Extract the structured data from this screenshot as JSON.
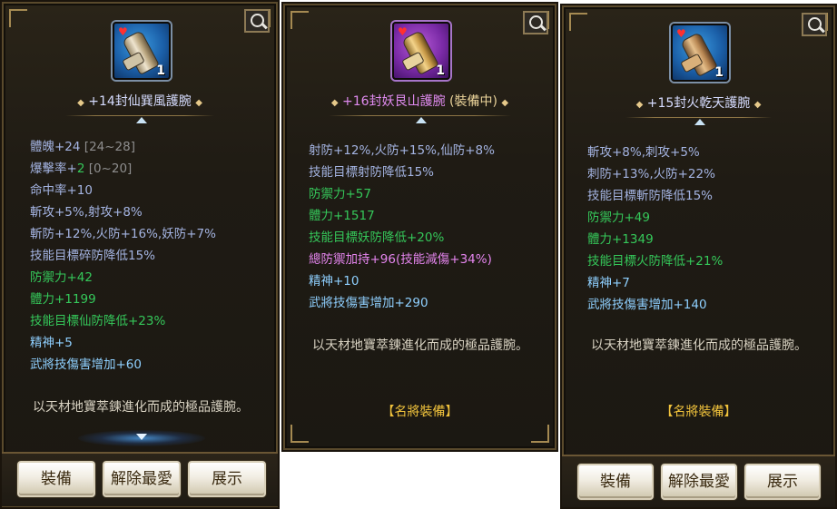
{
  "panels": [
    {
      "title": "+14封仙巽風護腕",
      "title_color": "#d6dcff",
      "icon": "bracer-icon",
      "icon_count": "1",
      "stats": [
        {
          "text": "體魄+24",
          "extra": "[24~28]",
          "color": "blue"
        },
        {
          "text": "爆擊率+",
          "extra_green": "2",
          "extra": "[0~20]",
          "color": "blue"
        },
        {
          "text": "命中率+10",
          "color": "blue"
        },
        {
          "text": "斬攻+5%,射攻+8%",
          "color": "blue"
        },
        {
          "text": "斬防+12%,火防+16%,妖防+7%",
          "color": "blue"
        },
        {
          "text": "技能目標碎防降低15%",
          "color": "blue"
        },
        {
          "text": "防禦力+42",
          "color": "green"
        },
        {
          "text": "體力+1199",
          "color": "green"
        },
        {
          "text": "技能目標仙防降低+23%",
          "color": "green"
        },
        {
          "text": "精神+5",
          "color": "cyan"
        },
        {
          "text": "武將技傷害增加+60",
          "color": "cyan"
        }
      ],
      "description": "以天材地寶萃鍊進化而成的極品護腕。",
      "buttons": [
        "裝備",
        "解除最愛",
        "展示"
      ]
    },
    {
      "title": "+16封妖艮山護腕",
      "title_suffix": "(裝備中)",
      "title_color": "#e08bf0",
      "icon": "bracer-icon",
      "icon_count": "1",
      "stats": [
        {
          "text": "射防+12%,火防+15%,仙防+8%",
          "color": "blue"
        },
        {
          "text": "技能目標射防降低15%",
          "color": "blue"
        },
        {
          "text": "防禦力+57",
          "color": "green"
        },
        {
          "text": "體力+1517",
          "color": "green"
        },
        {
          "text": "技能目標妖防降低+20%",
          "color": "green"
        },
        {
          "text": "總防禦加持+96(技能減傷+34%)",
          "color": "pink"
        },
        {
          "text": "精神+10",
          "color": "cyan"
        },
        {
          "text": "武將技傷害增加+290",
          "color": "cyan"
        }
      ],
      "description": "以天材地寶萃鍊進化而成的極品護腕。",
      "tag": "【名將裝備】"
    },
    {
      "title": "+15封火乾天護腕",
      "title_color": "#d6dcff",
      "icon": "bracer-icon",
      "icon_count": "1",
      "stats": [
        {
          "text": "斬攻+8%,刺攻+5%",
          "color": "blue"
        },
        {
          "text": "刺防+13%,火防+22%",
          "color": "blue"
        },
        {
          "text": "技能目標斬防降低15%",
          "color": "blue"
        },
        {
          "text": "防禦力+49",
          "color": "green"
        },
        {
          "text": "體力+1349",
          "color": "green"
        },
        {
          "text": "技能目標火防降低+21%",
          "color": "green"
        },
        {
          "text": "精神+7",
          "color": "cyan"
        },
        {
          "text": "武將技傷害增加+140",
          "color": "cyan"
        }
      ],
      "description": "以天材地寶萃鍊進化而成的極品護腕。",
      "tag": "【名將裝備】",
      "buttons": [
        "裝備",
        "解除最愛",
        "展示"
      ]
    }
  ]
}
